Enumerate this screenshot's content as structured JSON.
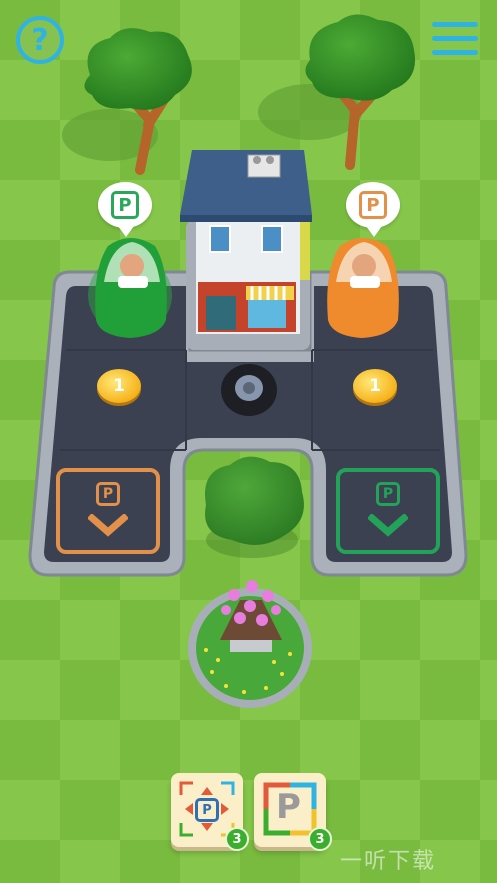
{
  "colors": {
    "grass_light": "#86c64a",
    "grass_dark": "#74b83c",
    "road": "#3b4150",
    "curb": "#9aa2ad",
    "accent_blue": "#2fb3e3",
    "orange_spot": "#e2904a",
    "green_spot": "#23a35a",
    "badge_green": "#3cae2e"
  },
  "hud": {
    "help_label": "?",
    "help_icon": "question-mark-icon",
    "menu_icon": "hamburger-menu-icon"
  },
  "cars": [
    {
      "color": "green",
      "parking_sign": "P",
      "sign_color": "#2aa85a"
    },
    {
      "color": "orange",
      "parking_sign": "P",
      "sign_color": "#e2904a"
    }
  ],
  "coins": [
    {
      "value": "1"
    },
    {
      "value": "1"
    }
  ],
  "parking_spots": [
    {
      "color": "orange",
      "sign": "P",
      "icon": "chevron-down-icon"
    },
    {
      "color": "green",
      "sign": "P",
      "icon": "chevron-down-icon"
    }
  ],
  "cards": [
    {
      "name": "move-card",
      "icon": "p-arrows-icon",
      "sign": "P",
      "count": "3"
    },
    {
      "name": "parking-card",
      "icon": "p-tile-icon",
      "sign": "P",
      "count": "3"
    }
  ],
  "watermark": "一听下载"
}
